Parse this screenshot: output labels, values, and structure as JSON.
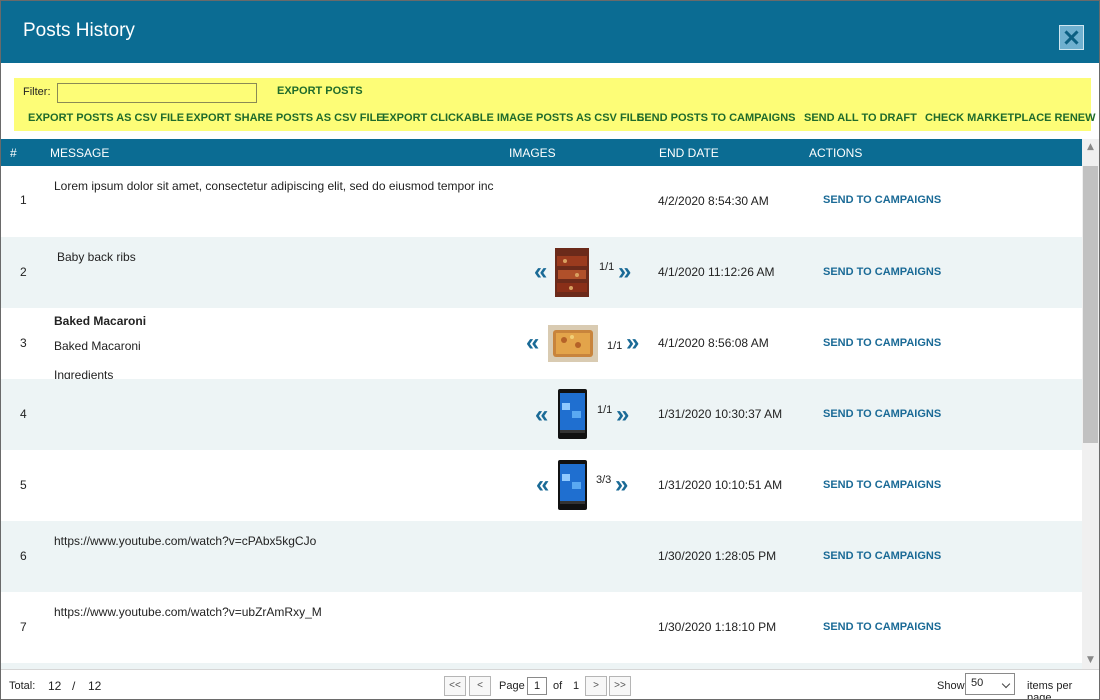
{
  "window": {
    "title": "Posts History"
  },
  "toolbar": {
    "filter_label": "Filter:",
    "filter_value": "",
    "export_posts": "EXPORT POSTS",
    "export_csv": "EXPORT POSTS AS CSV FILE",
    "export_share_csv": "EXPORT SHARE POSTS AS CSV FILE",
    "export_clickable_csv": "EXPORT CLICKABLE IMAGE POSTS AS CSV FILE",
    "send_to_campaigns": "SEND POSTS TO CAMPAIGNS",
    "send_all_draft": "SEND ALL TO DRAFT",
    "check_marketplace": "CHECK MARKETPLACE RENEW"
  },
  "columns": {
    "num": "#",
    "message": "MESSAGE",
    "images": "IMAGES",
    "end_date": "END DATE",
    "actions": "ACTIONS"
  },
  "rows": [
    {
      "num": "1",
      "message": "Lorem ipsum dolor sit amet, consectetur adipiscing elit, sed do eiusmod tempor inc",
      "images": "",
      "end_date": "4/2/2020 8:54:30 AM",
      "action": "SEND TO CAMPAIGNS"
    },
    {
      "num": "2",
      "message": "Baby back ribs",
      "images": "1/1",
      "end_date": "4/1/2020 11:12:26 AM",
      "action": "SEND TO CAMPAIGNS"
    },
    {
      "num": "3",
      "message_title": "Baked Macaroni",
      "message": "Baked Macaroni",
      "message_extra": "Ingredients",
      "images": "1/1",
      "end_date": "4/1/2020 8:56:08 AM",
      "action": "SEND TO CAMPAIGNS"
    },
    {
      "num": "4",
      "message": "",
      "images": "1/1",
      "end_date": "1/31/2020 10:30:37 AM",
      "action": "SEND TO CAMPAIGNS"
    },
    {
      "num": "5",
      "message": "",
      "images": "3/3",
      "end_date": "1/31/2020 10:10:51 AM",
      "action": "SEND TO CAMPAIGNS"
    },
    {
      "num": "6",
      "message": "https://www.youtube.com/watch?v=cPAbx5kgCJo",
      "images": "",
      "end_date": "1/30/2020 1:28:05 PM",
      "action": "SEND TO CAMPAIGNS"
    },
    {
      "num": "7",
      "message": "https://www.youtube.com/watch?v=ubZrAmRxy_M",
      "images": "",
      "end_date": "1/30/2020 1:18:10 PM",
      "action": "SEND TO CAMPAIGNS"
    }
  ],
  "footer": {
    "total_label": "Total:",
    "total_shown": "12",
    "separator": "/",
    "total_all": "12",
    "first": "<<",
    "prev": "<",
    "page_label": "Page",
    "page_value": "1",
    "of_label": "of",
    "page_count": "1",
    "next": ">",
    "last": ">>",
    "show_label": "Show",
    "per_page": "50",
    "per_page_label": "items per page"
  },
  "icons": {
    "prev_image": "chevron-double-left-icon",
    "next_image": "chevron-double-right-icon",
    "close": "close-icon"
  },
  "colors": {
    "header": "#0b6c93",
    "toolbar": "#fdfd77",
    "toolbar_link": "#1f6b2b",
    "action_link": "#1a6a96",
    "alt_row": "#edf4f5"
  }
}
